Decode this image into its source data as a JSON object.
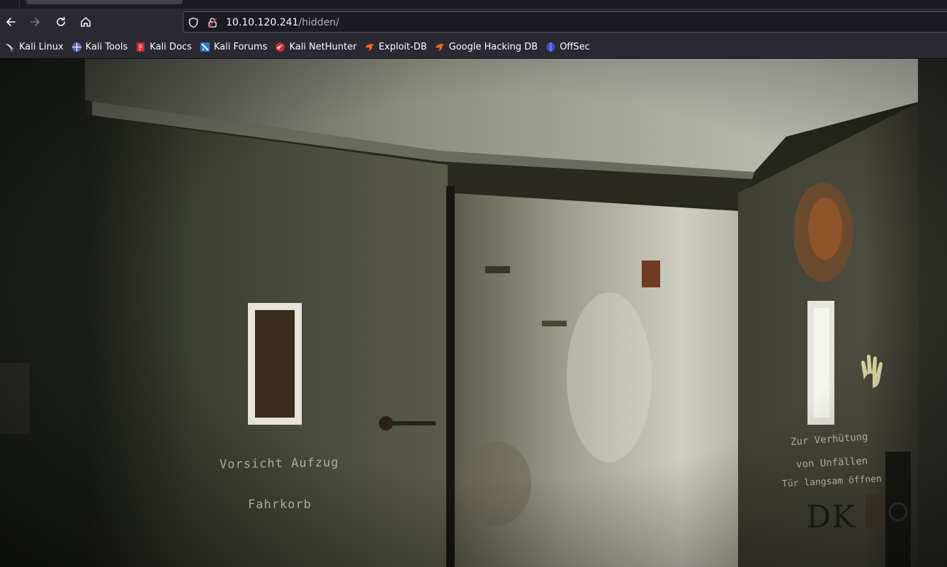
{
  "browser": {
    "url": {
      "host": "10.10.120.241",
      "path": "/hidden/"
    }
  },
  "bookmarks": [
    {
      "label": "Kali Linux",
      "icon": "kali-dragon-icon"
    },
    {
      "label": "Kali Tools",
      "icon": "kali-tools-icon"
    },
    {
      "label": "Kali Docs",
      "icon": "kali-docs-icon"
    },
    {
      "label": "Kali Forums",
      "icon": "kali-forums-icon"
    },
    {
      "label": "Kali NetHunter",
      "icon": "nethunter-icon"
    },
    {
      "label": "Exploit-DB",
      "icon": "exploit-db-icon"
    },
    {
      "label": "Google Hacking DB",
      "icon": "ghdb-icon"
    },
    {
      "label": "OffSec",
      "icon": "offsec-icon"
    }
  ],
  "page": {
    "image_text": {
      "left_door_line1": "Vorsicht  Aufzug",
      "left_door_line2": "Fahrkorb",
      "right_door_line1": "Zur Verhütung",
      "right_door_line2": "von Unfällen",
      "right_door_line3": "Tür langsam öffnen",
      "graffiti": "DK"
    }
  },
  "colors": {
    "toolbar": "#2b2a33",
    "urlbar_bg": "#1c1b22",
    "text": "#fbfbfe"
  }
}
